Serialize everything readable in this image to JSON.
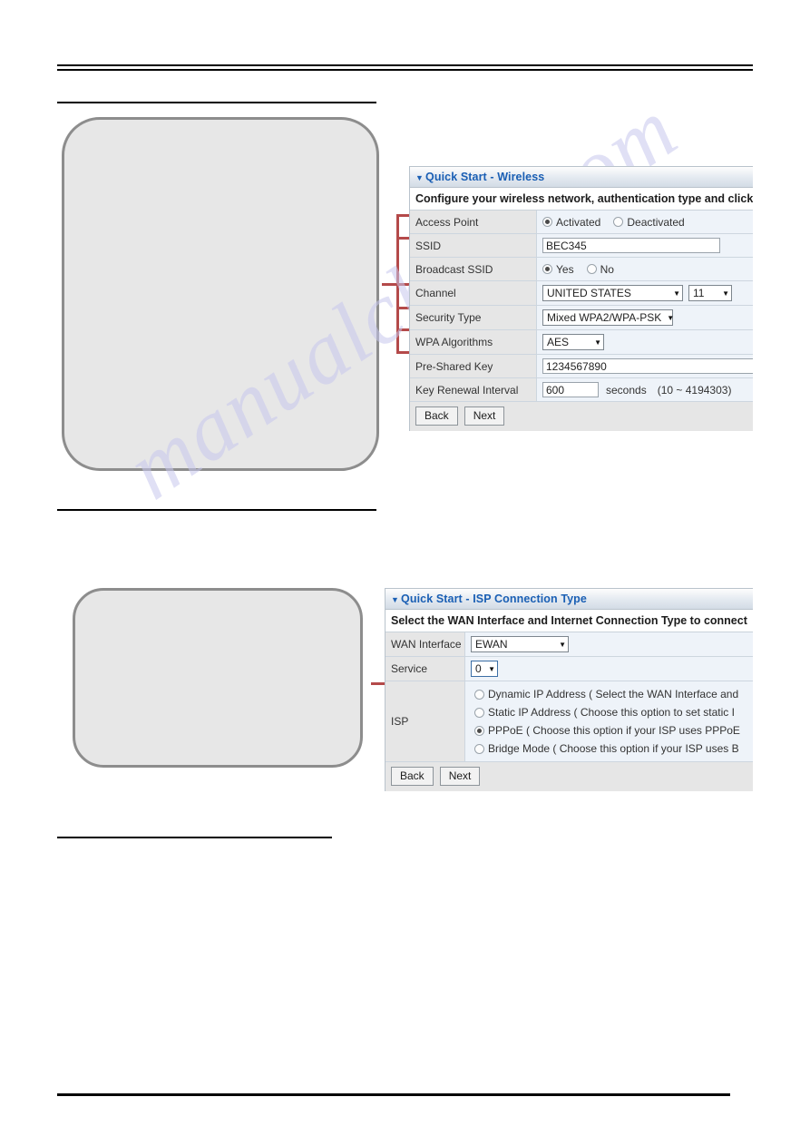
{
  "watermark": {
    "text": "manualchive.com"
  },
  "figures": {
    "wireless_placeholder_caption": "",
    "isp_placeholder_caption": ""
  },
  "wireless_panel": {
    "caret": "▼",
    "title": "Quick Start - Wireless",
    "subtitle": "Configure your wireless network, authentication type and click NEXT",
    "rows": {
      "access_point": {
        "label": "Access Point",
        "options": [
          {
            "label": "Activated",
            "selected": true
          },
          {
            "label": "Deactivated",
            "selected": false
          }
        ]
      },
      "ssid": {
        "label": "SSID",
        "value": "BEC345"
      },
      "broadcast_ssid": {
        "label": "Broadcast SSID",
        "options": [
          {
            "label": "Yes",
            "selected": true
          },
          {
            "label": "No",
            "selected": false
          }
        ]
      },
      "channel": {
        "label": "Channel",
        "country": "UNITED STATES",
        "number": "11"
      },
      "security_type": {
        "label": "Security Type",
        "value": "Mixed WPA2/WPA-PSK"
      },
      "wpa_algorithms": {
        "label": "WPA Algorithms",
        "value": "AES"
      },
      "pre_shared_key": {
        "label": "Pre-Shared Key",
        "value": "1234567890"
      },
      "key_renewal_interval": {
        "label": "Key Renewal Interval",
        "value": "600",
        "unit": "seconds",
        "range": "(10 ~ 4194303)"
      }
    },
    "buttons": {
      "back": "Back",
      "next": "Next"
    },
    "dropdown_arrow": "▼"
  },
  "isp_panel": {
    "caret": "▼",
    "title": "Quick Start - ISP Connection Type",
    "subtitle": "Select the WAN Interface and Internet Connection Type to connect",
    "rows": {
      "wan_interface": {
        "label": "WAN Interface",
        "value": "EWAN"
      },
      "service": {
        "label": "Service",
        "value": "0"
      },
      "isp": {
        "label": "ISP",
        "options": [
          {
            "label": "Dynamic IP Address ( Select the WAN Interface and",
            "selected": false
          },
          {
            "label": "Static IP Address ( Choose this option to set static I",
            "selected": false
          },
          {
            "label": "PPPoE ( Choose this option if your ISP uses PPPoE",
            "selected": true
          },
          {
            "label": "Bridge Mode ( Choose this option if your ISP uses B",
            "selected": false
          }
        ]
      }
    },
    "buttons": {
      "back": "Back",
      "next": "Next"
    },
    "dropdown_arrow": "▼"
  }
}
